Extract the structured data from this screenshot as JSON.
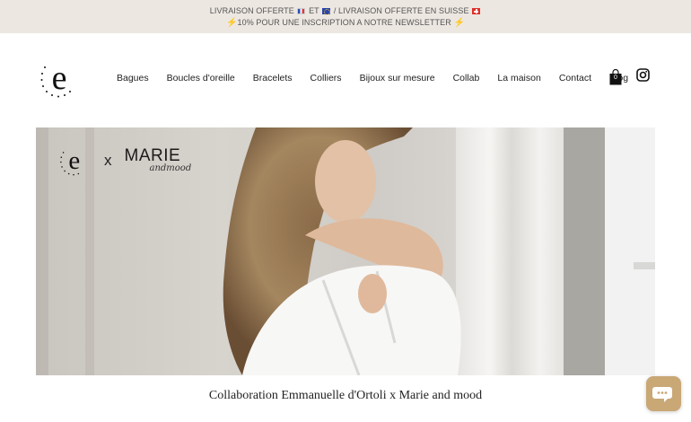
{
  "announcement": {
    "line1_part1": "LIVRAISON OFFERTE",
    "line1_part2": "ET",
    "line1_part3": "/ LIVRAISON OFFERTE EN SUISSE",
    "line2": "10% POUR UNE INSCRIPTION A NOTRE NEWSLETTER",
    "bolt": "⚡"
  },
  "header": {
    "logo_letter": "e",
    "nav": [
      "Bagues",
      "Boucles d'oreille",
      "Bracelets",
      "Colliers",
      "Bijoux sur mesure",
      "Collab",
      "La maison",
      "Contact",
      "Blog"
    ],
    "cart_count": "0"
  },
  "hero": {
    "logo_letter": "e",
    "x": "x",
    "marie": "MARIE",
    "andmood": "andmood"
  },
  "caption": "Collaboration Emmanuelle d'Ortoli x Marie and mood",
  "colors": {
    "announcement_bg": "#ece7e1",
    "chat_button": "#c9a876"
  },
  "icons": [
    "logo-icon",
    "cart-icon",
    "instagram-icon",
    "chat-icon"
  ]
}
